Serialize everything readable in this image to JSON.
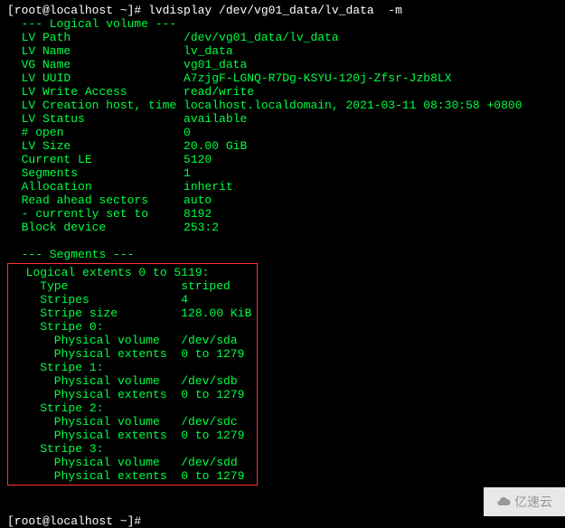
{
  "prompt1": "[root@localhost ~]# lvdisplay /dev/vg01_data/lv_data  -m",
  "lv_header": "  --- Logical volume ---",
  "lv_rows": [
    "  LV Path                /dev/vg01_data/lv_data",
    "  LV Name                lv_data",
    "  VG Name                vg01_data",
    "  LV UUID                A7zjgF-LGNQ-R7Dg-KSYU-120j-Zfsr-Jzb8LX",
    "  LV Write Access        read/write",
    "  LV Creation host, time localhost.localdomain, 2021-03-11 08:30:58 +0800",
    "  LV Status              available",
    "  # open                 0",
    "  LV Size                20.00 GiB",
    "  Current LE             5120",
    "  Segments               1",
    "  Allocation             inherit",
    "  Read ahead sectors     auto",
    "  - currently set to     8192",
    "  Block device           253:2"
  ],
  "blank1": " ",
  "seg_header": "  --- Segments ---",
  "seg_rows": [
    "  Logical extents 0 to 5119:",
    "    Type                striped",
    "    Stripes             4",
    "    Stripe size         128.00 KiB",
    "    Stripe 0:",
    "      Physical volume   /dev/sda",
    "      Physical extents  0 to 1279",
    "    Stripe 1:",
    "      Physical volume   /dev/sdb",
    "      Physical extents  0 to 1279",
    "    Stripe 2:",
    "      Physical volume   /dev/sdc",
    "      Physical extents  0 to 1279",
    "    Stripe 3:",
    "      Physical volume   /dev/sdd",
    "      Physical extents  0 to 1279"
  ],
  "blank2": " ",
  "prompt2": "[root@localhost ~]# ",
  "watermark": "亿速云"
}
